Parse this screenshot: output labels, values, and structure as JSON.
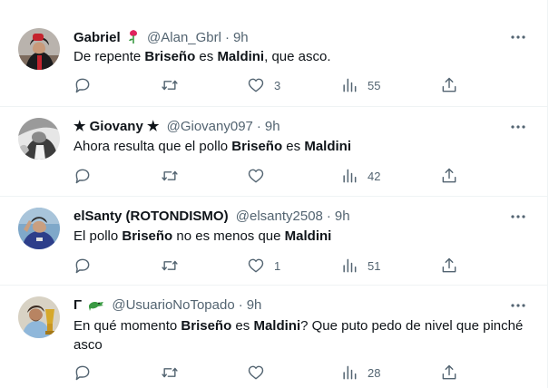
{
  "tweets": [
    {
      "name": "Gabriel",
      "badge_icon": "rose-icon",
      "handle": "@Alan_Gbrl",
      "separator": "·",
      "time": "9h",
      "text_parts": [
        "De repente ",
        "Briseño",
        " es ",
        "Maldini",
        ", que asco."
      ],
      "replies": "",
      "retweets": "",
      "likes": "3",
      "views": "55"
    },
    {
      "name": "★ Giovany ★",
      "handle": "@Giovany097",
      "separator": "·",
      "time": "9h",
      "text_parts": [
        "Ahora resulta que el pollo ",
        "Briseño",
        " es ",
        "Maldini",
        ""
      ],
      "replies": "",
      "retweets": "",
      "likes": "",
      "views": "42"
    },
    {
      "name": "elSanty (ROTONDISMO)",
      "handle": "@elsanty2508",
      "separator": "·",
      "time": "9h",
      "text_parts": [
        "El pollo ",
        "Briseño",
        " no es menos que ",
        "Maldini",
        ""
      ],
      "replies": "",
      "retweets": "",
      "likes": "1",
      "views": "51"
    },
    {
      "name": "Γ",
      "badge_icon": "crocodile-icon",
      "handle": "@UsuarioNoTopado",
      "separator": "·",
      "time": "9h",
      "text_parts": [
        "En qué momento ",
        "Briseño",
        " es ",
        "Maldini",
        "? Que puto pedo de nivel que pinché asco"
      ],
      "replies": "",
      "retweets": "",
      "likes": "",
      "views": "28"
    }
  ],
  "colors": {
    "text": "#0f1419",
    "secondary": "#536471",
    "divider": "#eff3f4"
  }
}
